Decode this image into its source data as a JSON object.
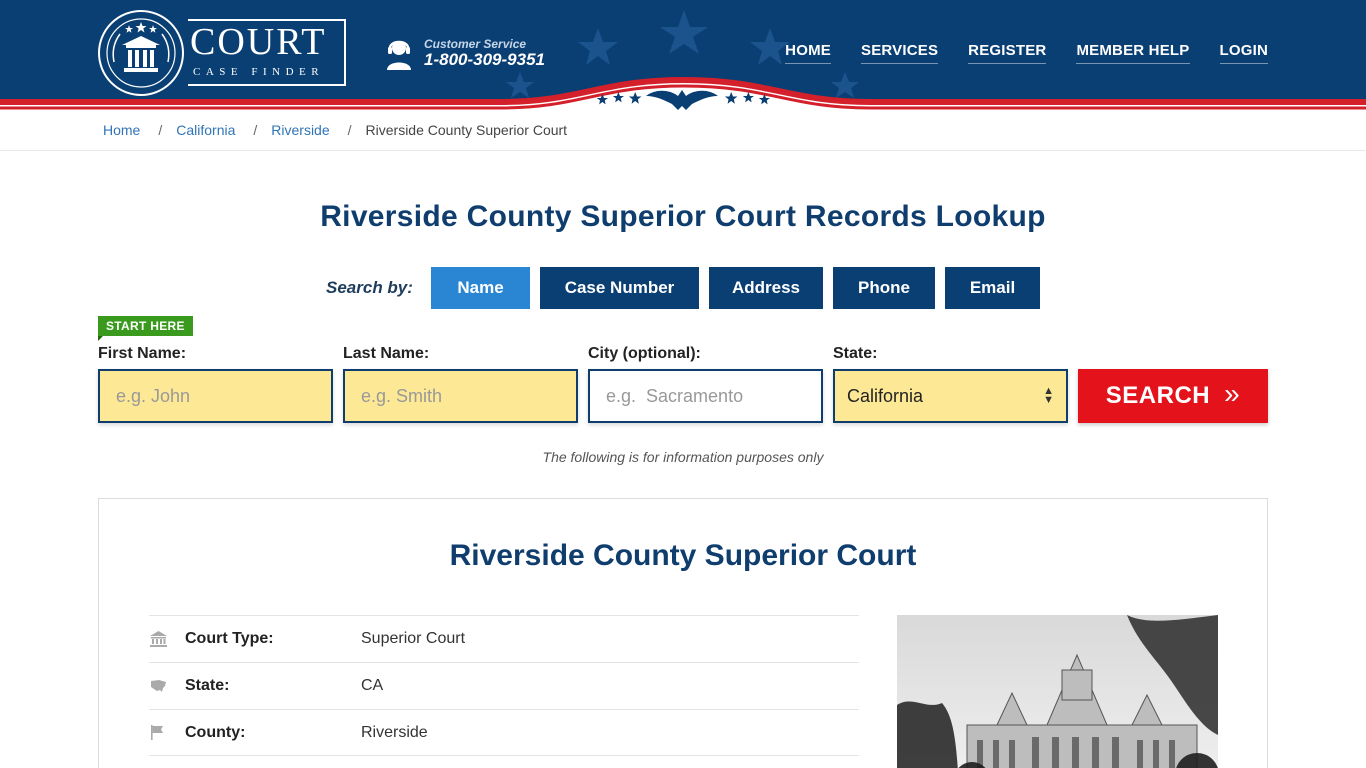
{
  "logo": {
    "title": "COURT",
    "subtitle": "CASE FINDER"
  },
  "customer_service": {
    "label": "Customer Service",
    "phone": "1-800-309-9351"
  },
  "nav": {
    "items": [
      "HOME",
      "SERVICES",
      "REGISTER",
      "MEMBER HELP",
      "LOGIN"
    ]
  },
  "breadcrumb": {
    "items": [
      "Home",
      "California",
      "Riverside"
    ],
    "current": "Riverside County Superior Court"
  },
  "lookup": {
    "title": "Riverside County Superior Court Records Lookup",
    "search_by_label": "Search by:",
    "tabs": [
      "Name",
      "Case Number",
      "Address",
      "Phone",
      "Email"
    ],
    "active_tab": "Name",
    "start_here": "START HERE",
    "fields": {
      "first_name": {
        "label": "First Name:",
        "placeholder": "e.g. John"
      },
      "last_name": {
        "label": "Last Name:",
        "placeholder": "e.g. Smith"
      },
      "city": {
        "label": "City (optional):",
        "placeholder": "e.g.  Sacramento"
      },
      "state": {
        "label": "State:",
        "value": "California"
      }
    },
    "search_button": "SEARCH",
    "note": "The following is for information purposes only"
  },
  "court": {
    "title": "Riverside County Superior Court",
    "rows": [
      {
        "icon": "courthouse-icon",
        "key": "Court Type:",
        "value": "Superior Court"
      },
      {
        "icon": "usa-map-icon",
        "key": "State:",
        "value": "CA"
      },
      {
        "icon": "flag-icon",
        "key": "County:",
        "value": "Riverside"
      }
    ]
  },
  "colors": {
    "navy": "#0a3f74",
    "accent_blue": "#2a86d2",
    "red": "#e3121b",
    "input_yellow": "#fde896",
    "green": "#3a9a1e"
  }
}
